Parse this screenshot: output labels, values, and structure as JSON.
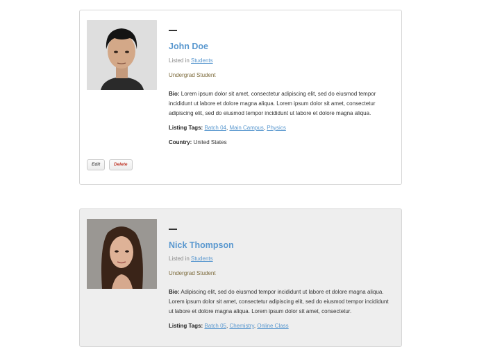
{
  "listings": [
    {
      "name": "John Doe",
      "listed_prefix": "Listed in",
      "listed_category": "Students",
      "role": "Undergrad Student",
      "bio_label": "Bio:",
      "bio_text": "Lorem ipsum dolor sit amet, consectetur adipiscing elit, sed do eiusmod tempor incididunt ut labore et dolore magna aliqua. Lorem ipsum dolor sit amet, consectetur adipiscing elit, sed do eiusmod tempor incididunt ut labore et dolore magna aliqua.",
      "tags_label": "Listing Tags:",
      "tags": [
        "Batch 04",
        "Main Campus",
        "Physics"
      ],
      "country_label": "Country:",
      "country": "United States",
      "edit_label": "Edit",
      "delete_label": "Delete"
    },
    {
      "name": "Nick Thompson",
      "listed_prefix": "Listed in",
      "listed_category": "Students",
      "role": "Undergrad Student",
      "bio_label": "Bio:",
      "bio_text": "Adipiscing elit, sed do eiusmod tempor incididunt ut labore et dolore magna aliqua. Lorem ipsum dolor sit amet, consectetur adipiscing elit, sed do eiusmod tempor incididunt ut labore et dolore magna aliqua. Lorem ipsum dolor sit amet, consectetur.",
      "tags_label": "Listing Tags:",
      "tags": [
        "Batch 05",
        "Chemistry",
        "Online Class"
      ]
    }
  ],
  "colors": {
    "link": "#5a98cf",
    "role": "#7d6b3c",
    "delete": "#c0392b",
    "card2_bg": "#eeeeee"
  }
}
